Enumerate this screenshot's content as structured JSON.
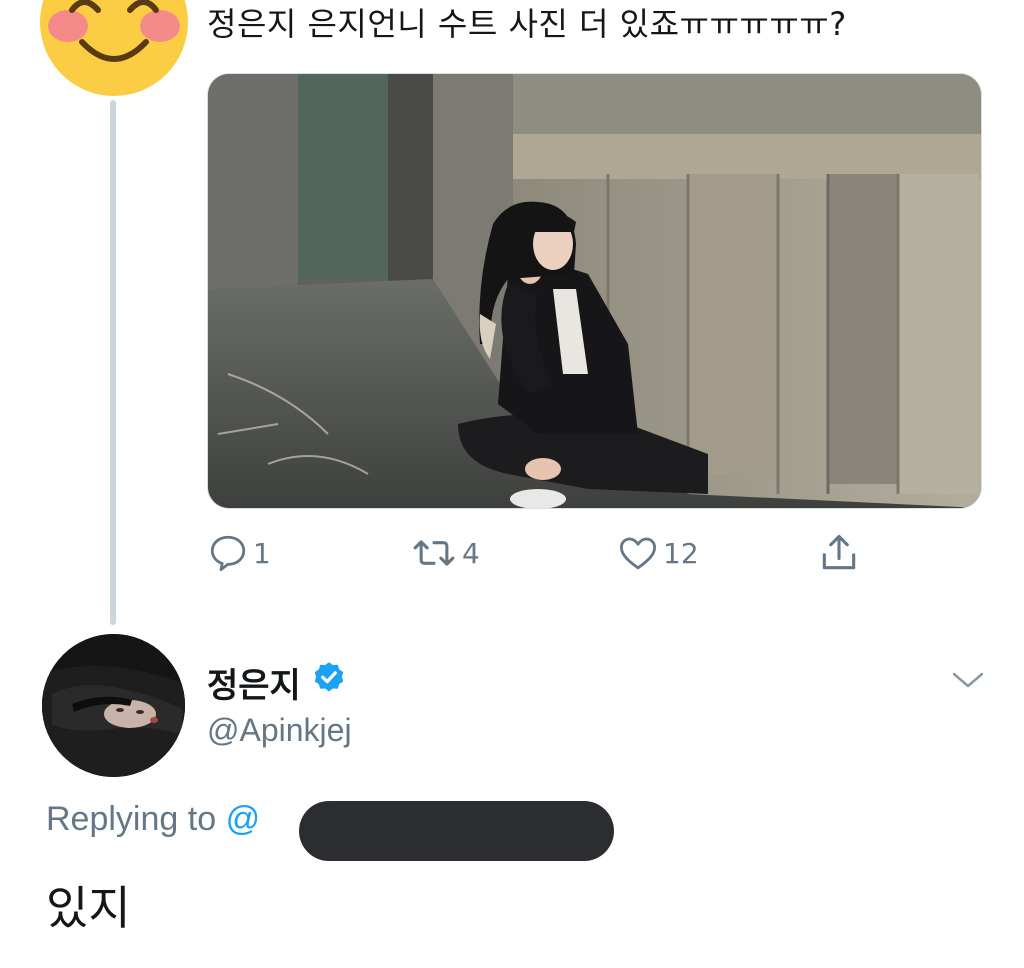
{
  "parent_tweet": {
    "avatar_icon": "smiling-face-with-blush-icon",
    "text": "정은지 은지언니 수트 사진 더 있죠ㅠㅠㅠㅠㅠ?",
    "stats": {
      "replies": "1",
      "retweets": "4",
      "likes": "12"
    }
  },
  "reply_tweet": {
    "display_name": "정은지",
    "verified": true,
    "handle": "@Apinkjej",
    "replying_label": "Replying to",
    "replying_at": "@",
    "text": "있지"
  },
  "colors": {
    "accent": "#1da1f2",
    "muted": "#657786",
    "thread_line": "#ccd6dd",
    "redaction": "#2b2d30"
  }
}
